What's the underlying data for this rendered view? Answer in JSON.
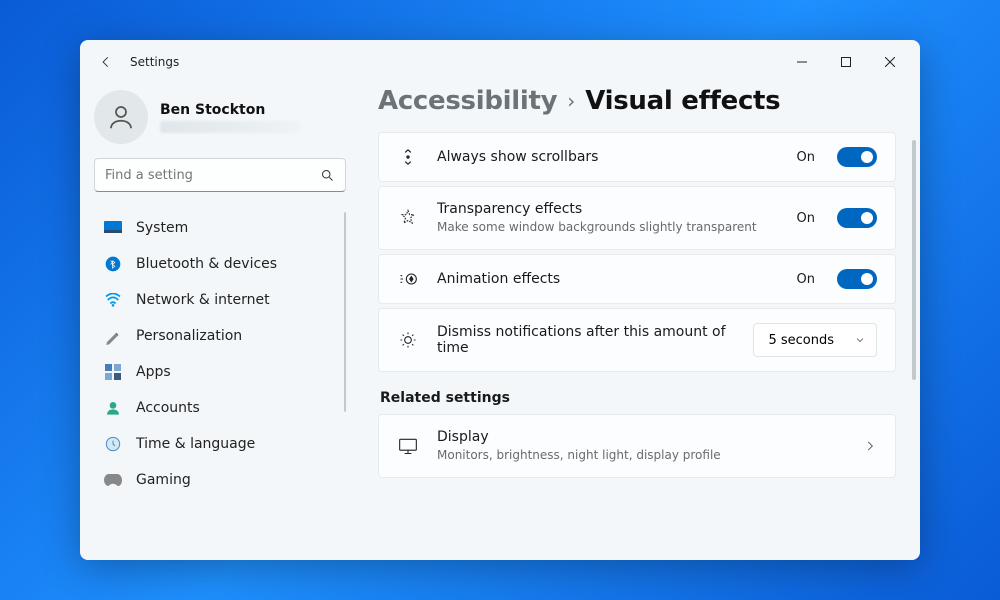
{
  "window": {
    "title": "Settings"
  },
  "user": {
    "name": "Ben Stockton"
  },
  "search": {
    "placeholder": "Find a setting"
  },
  "nav": {
    "items": [
      {
        "label": "System"
      },
      {
        "label": "Bluetooth & devices"
      },
      {
        "label": "Network & internet"
      },
      {
        "label": "Personalization"
      },
      {
        "label": "Apps"
      },
      {
        "label": "Accounts"
      },
      {
        "label": "Time & language"
      },
      {
        "label": "Gaming"
      }
    ]
  },
  "breadcrumb": {
    "parent": "Accessibility",
    "current": "Visual effects"
  },
  "settings": {
    "scrollbars": {
      "title": "Always show scrollbars",
      "state": "On"
    },
    "transparency": {
      "title": "Transparency effects",
      "desc": "Make some window backgrounds slightly transparent",
      "state": "On"
    },
    "animation": {
      "title": "Animation effects",
      "state": "On"
    },
    "dismiss": {
      "title": "Dismiss notifications after this amount of time",
      "value": "5 seconds"
    }
  },
  "related": {
    "heading": "Related settings",
    "display": {
      "title": "Display",
      "desc": "Monitors, brightness, night light, display profile"
    }
  },
  "colors": {
    "accent": "#0067c0"
  }
}
